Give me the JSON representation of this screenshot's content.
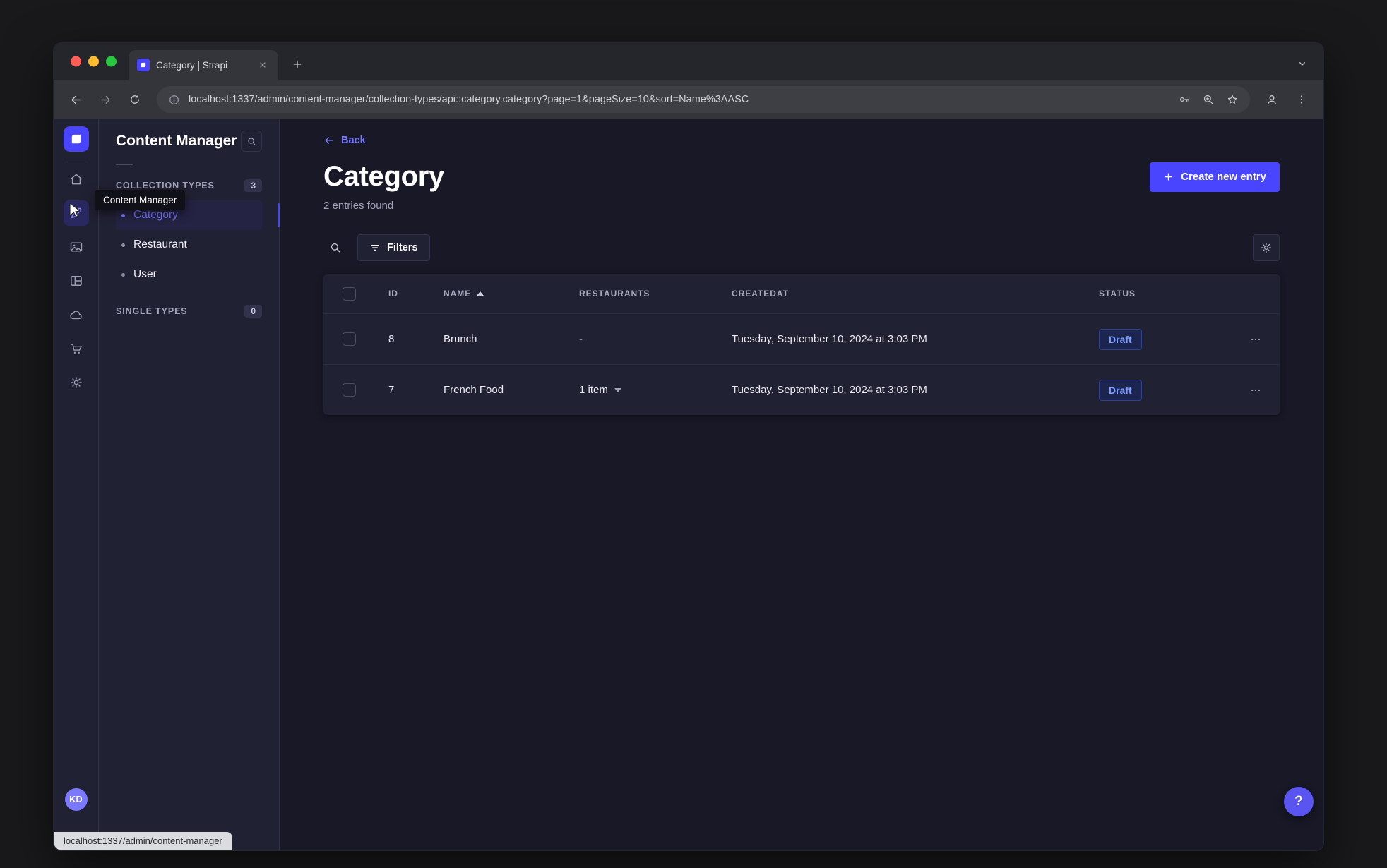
{
  "browser": {
    "tab_title": "Category | Strapi",
    "url": "localhost:1337/admin/content-manager/collection-types/api::category.category?page=1&pageSize=10&sort=Name%3AASC",
    "status_link": "localhost:1337/admin/content-manager"
  },
  "nav": {
    "tooltip": "Content Manager",
    "avatar_initials": "KD",
    "items": [
      "home",
      "content-manager",
      "media-library",
      "content-type-builder",
      "deploy",
      "marketplace",
      "settings"
    ]
  },
  "sidebar": {
    "title": "Content Manager",
    "sections": [
      {
        "label": "COLLECTION TYPES",
        "count": "3"
      },
      {
        "label": "SINGLE TYPES",
        "count": "0"
      }
    ],
    "items": [
      {
        "label": "Category",
        "active": true
      },
      {
        "label": "Restaurant",
        "active": false
      },
      {
        "label": "User",
        "active": false
      }
    ]
  },
  "main": {
    "back_label": "Back",
    "title": "Category",
    "subtitle": "2 entries found",
    "create_button_label": "Create new entry",
    "filters_button_label": "Filters",
    "help_label": "?"
  },
  "table": {
    "headers": {
      "id": "ID",
      "name": "NAME",
      "restaurants": "RESTAURANTS",
      "createdat": "CREATEDAT",
      "status": "STATUS"
    },
    "rows": [
      {
        "id": "8",
        "name": "Brunch",
        "restaurants": "-",
        "createdat": "Tuesday, September 10, 2024 at 3:03 PM",
        "status": "Draft"
      },
      {
        "id": "7",
        "name": "French Food",
        "restaurants": "1 item",
        "createdat": "Tuesday, September 10, 2024 at 3:03 PM",
        "status": "Draft"
      }
    ]
  },
  "colors": {
    "primary": "#4945ff",
    "primary_light": "#7b79ff",
    "app_background": "#181826",
    "surface": "#212134",
    "border": "#32324d",
    "muted_text": "#a5a5ba",
    "draft_badge_text": "#7b9dff"
  }
}
